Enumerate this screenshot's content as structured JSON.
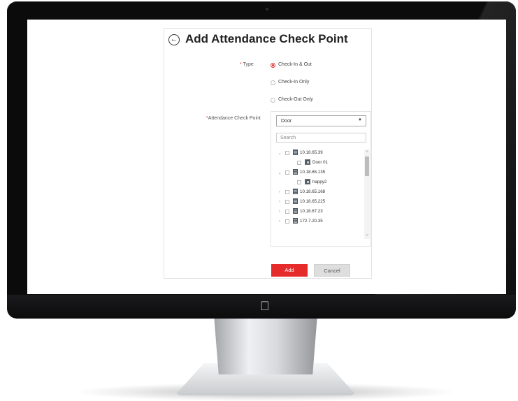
{
  "page": {
    "title": "Add Attendance Check Point"
  },
  "type_field": {
    "required_mark": "*",
    "label": "Type",
    "options": [
      {
        "label": "Check-In & Out",
        "selected": true
      },
      {
        "label": "Check-In Only",
        "selected": false
      },
      {
        "label": "Check-Out Only",
        "selected": false
      }
    ]
  },
  "checkpoint_field": {
    "required_mark": "*",
    "label": "Attendance Check Point",
    "selected_value": "Door",
    "search_placeholder": "Search",
    "tree": [
      {
        "label": "10.18.65.39",
        "kind": "device",
        "expanded": true,
        "level": 0
      },
      {
        "label": "Door 01",
        "kind": "door",
        "level": 1
      },
      {
        "label": "10.18.65.135",
        "kind": "device",
        "expanded": true,
        "level": 0
      },
      {
        "label": "happy2",
        "kind": "door",
        "level": 1
      },
      {
        "label": "10.18.65.168",
        "kind": "device",
        "expanded": false,
        "level": 0
      },
      {
        "label": "10.18.65.225",
        "kind": "device",
        "expanded": false,
        "level": 0
      },
      {
        "label": "10.18.67.23",
        "kind": "device",
        "expanded": false,
        "level": 0
      },
      {
        "label": "172.7.20.35",
        "kind": "device",
        "expanded": false,
        "level": 0
      }
    ]
  },
  "actions": {
    "add_label": "Add",
    "cancel_label": "Cancel"
  },
  "colors": {
    "accent": "#e62b2b",
    "required": "#e23434"
  }
}
